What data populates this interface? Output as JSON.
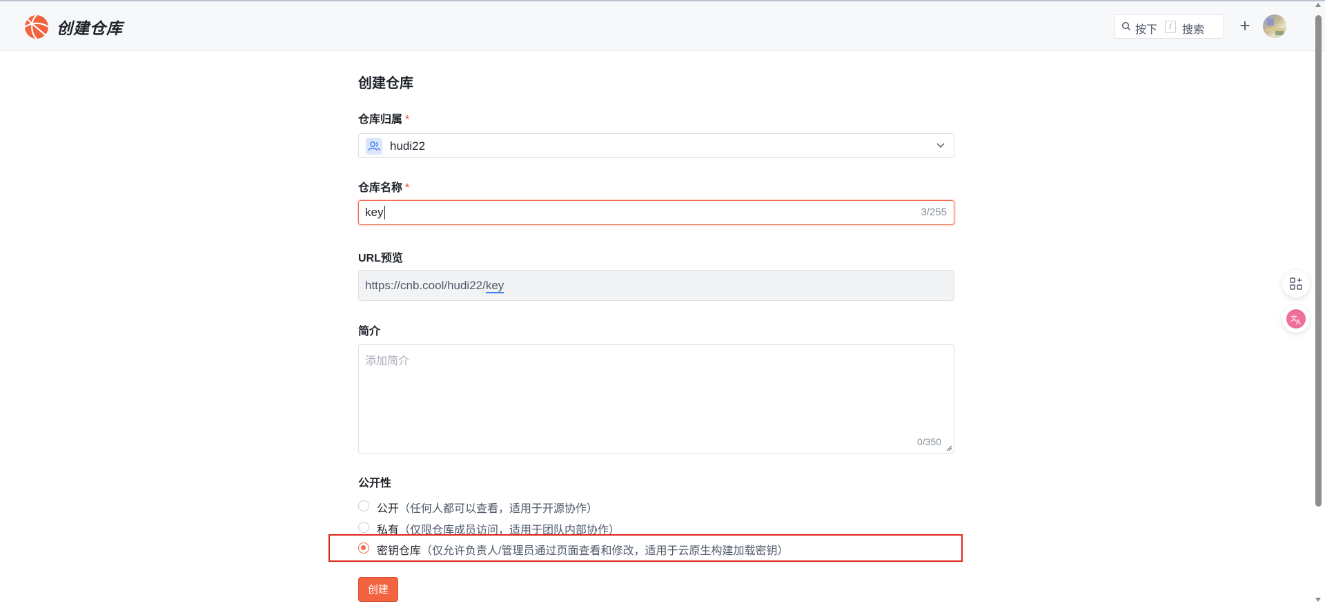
{
  "header": {
    "app_title": "创建仓库",
    "search": {
      "prefix": "按下",
      "key": "/",
      "suffix": "搜索"
    },
    "plus_label": "+"
  },
  "form": {
    "title": "创建仓库",
    "owner": {
      "label": "仓库归属",
      "required_mark": "*",
      "value": "hudi22"
    },
    "name": {
      "label": "仓库名称",
      "required_mark": "*",
      "value": "key",
      "counter": "3/255"
    },
    "url_preview": {
      "label": "URL预览",
      "base": "https://cnb.cool/hudi22/",
      "suffix": "key"
    },
    "description": {
      "label": "简介",
      "placeholder": "添加简介",
      "counter": "0/350"
    },
    "visibility": {
      "label": "公开性",
      "options": [
        {
          "name": "公开",
          "desc": "（任何人都可以查看，适用于开源协作）",
          "selected": false
        },
        {
          "name": "私有",
          "desc": "（仅限仓库成员访问，适用于团队内部协作）",
          "selected": false
        },
        {
          "name": "密钥仓库",
          "desc": "（仅允许负责人/管理员通过页面查看和修改，适用于云原生构建加载密钥）",
          "selected": true
        }
      ]
    },
    "submit_label": "创建"
  },
  "colors": {
    "accent": "#f2643f",
    "highlight_box": "#e0261b"
  },
  "icons": [
    "logo-icon",
    "search-icon",
    "plus-icon",
    "user-group-icon",
    "chevron-down-icon",
    "apps-icon",
    "translate-icon"
  ]
}
